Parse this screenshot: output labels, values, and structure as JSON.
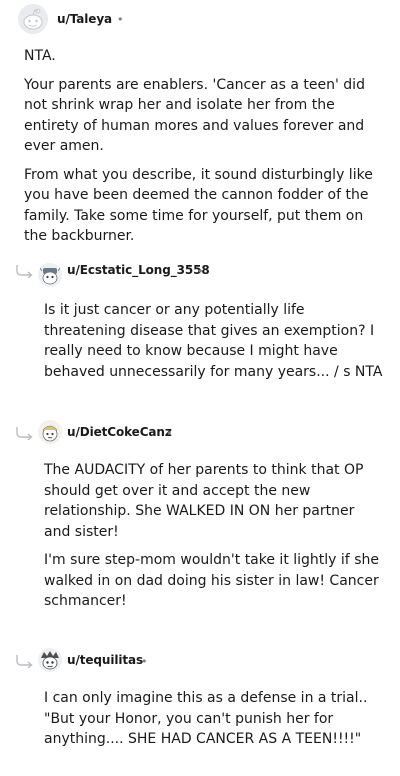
{
  "comments": [
    {
      "username": "u/Taleya",
      "separator": "•",
      "paragraphs": [
        "NTA.",
        "Your parents are enablers. 'Cancer as a teen' did not shrink wrap her and isolate her from the entirety of human mores and values forever and ever amen.",
        "From what you describe, it sound disturbingly like you have been deemed the cannon fodder of the family. Take some time for yourself, put them on the backburner."
      ]
    },
    {
      "username": "u/Ecstatic_Long_3558",
      "separator": "•",
      "paragraphs": [
        "Is it just cancer or any potentially life threatening disease that gives an exemption? I really need to know because I might have behaved unnecessarily for many years... / s NTA"
      ]
    },
    {
      "username": "u/DietCokeCanz",
      "separator": "•",
      "paragraphs": [
        "The AUDACITY of her parents to think that OP should get over it and accept the new relationship. She WALKED IN ON her partner and sister!",
        "I'm sure step-mom wouldn't take it lightly if she walked in on dad doing his sister in law! Cancer schmancer!"
      ]
    },
    {
      "username": "u/tequilitas",
      "separator": "•",
      "paragraphs": [
        "I can only imagine this as a defense in a trial.. \"But your Honor, you can't punish her for anything.... SHE HAD CANCER AS A TEEN!!!!\""
      ]
    }
  ],
  "colors": {
    "text": "#1a1a1b",
    "meta": "#787c7e",
    "thread_line": "#c8cbcd"
  },
  "icons": {
    "reply": "reply-curve-icon",
    "avatar": "snoo-avatar-icon"
  }
}
